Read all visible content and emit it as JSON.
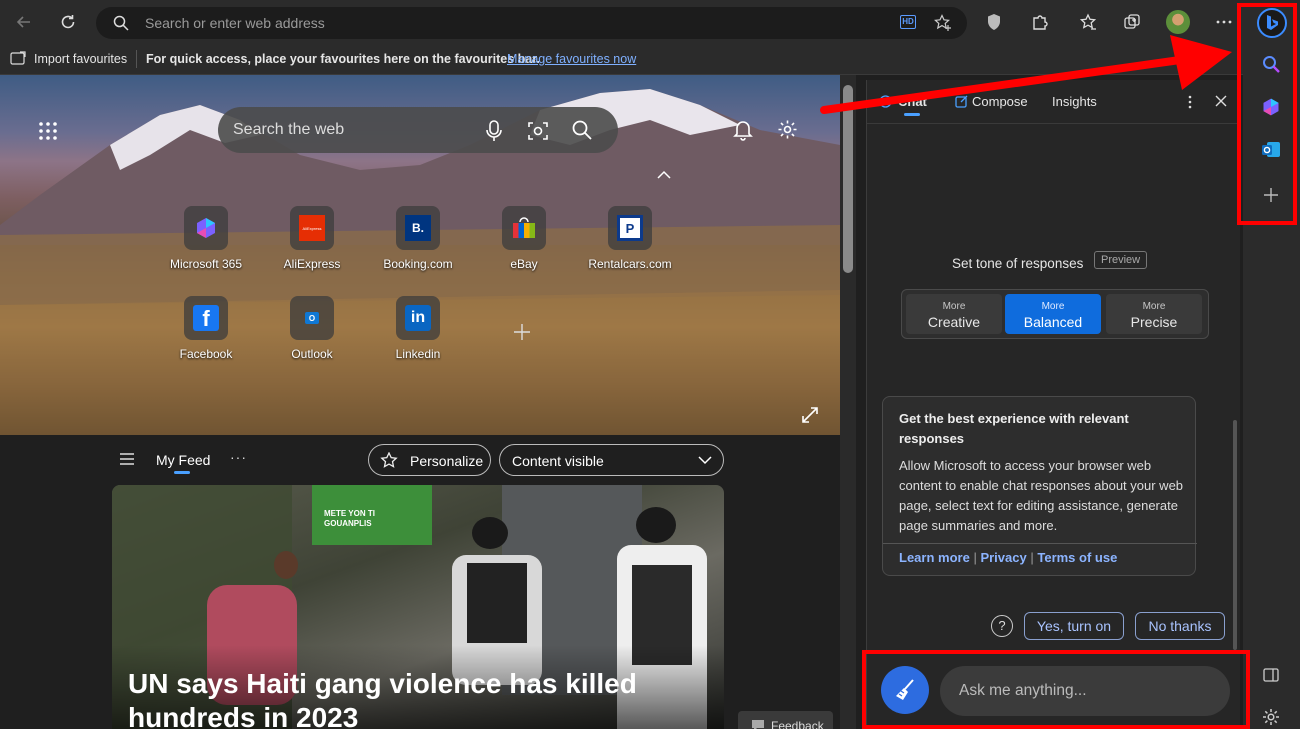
{
  "toolbar": {
    "address_placeholder": "Search or enter web address",
    "hd_badge": "HD"
  },
  "favbar": {
    "import_label": "Import favourites",
    "message": "For quick access, place your favourites here on the favourites bar.",
    "manage_link": "Manage favourites now"
  },
  "newtab": {
    "search_placeholder": "Search the web",
    "tiles": [
      {
        "label": "Microsoft 365"
      },
      {
        "label": "AliExpress",
        "glyph": "AliExpress"
      },
      {
        "label": "Booking.com",
        "glyph": "B."
      },
      {
        "label": "eBay"
      },
      {
        "label": "Rentalcars.com",
        "glyph": "P"
      },
      {
        "label": "Facebook",
        "glyph": "f"
      },
      {
        "label": "Outlook",
        "glyph": "O"
      },
      {
        "label": "Linkedin",
        "glyph": "in"
      }
    ],
    "feed_tab": "My Feed",
    "personalize_label": "Personalize",
    "content_select": "Content visible",
    "headline": "UN says Haiti gang violence has killed hundreds in 2023",
    "sign_text": "METE YON TI GOUANPLIS",
    "feedback_label": "Feedback"
  },
  "chat": {
    "tabs": [
      "Chat",
      "Compose",
      "Insights"
    ],
    "tone_title": "Set tone of responses",
    "preview_badge": "Preview",
    "tones": [
      {
        "small": "More",
        "label": "Creative",
        "selected": false
      },
      {
        "small": "More",
        "label": "Balanced",
        "selected": true
      },
      {
        "small": "More",
        "label": "Precise",
        "selected": false
      }
    ],
    "card_title": "Get the best experience with relevant responses",
    "card_body": "Allow Microsoft to access your browser web content to enable chat responses about your web page, select text for editing assistance, generate page summaries and more.",
    "links": [
      "Learn more",
      "Privacy",
      "Terms of use"
    ],
    "sep": "|",
    "help_glyph": "?",
    "yes_label": "Yes, turn on",
    "no_label": "No thanks",
    "input_placeholder": "Ask me anything..."
  },
  "colors": {
    "accent_blue": "#0f6cbd",
    "link_blue": "#8cb4ff",
    "annotation_red": "#ff0000"
  }
}
